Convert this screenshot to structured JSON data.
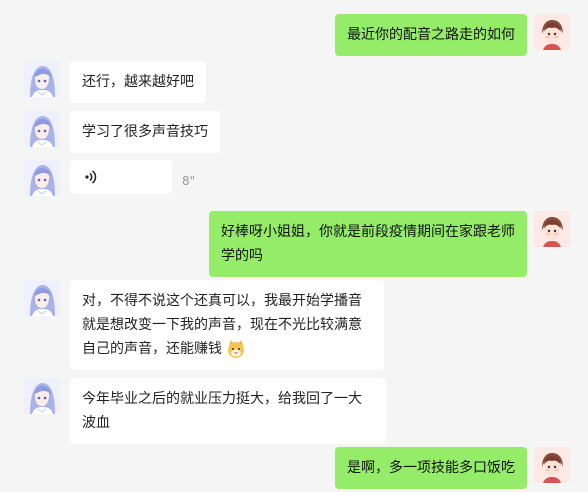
{
  "messages": [
    {
      "side": "out",
      "text": "最近你的配音之路走的如何"
    },
    {
      "side": "in",
      "text": "还行，越来越好吧"
    },
    {
      "side": "in",
      "text": "学习了很多声音技巧"
    },
    {
      "side": "in",
      "type": "voice",
      "icon": "voice-wave-icon",
      "duration": "8\""
    },
    {
      "side": "out",
      "text": "好棒呀小姐姐，你就是前段疫情期间在家跟老师学的吗"
    },
    {
      "side": "in",
      "text": "对，不得不说这个还真可以，我最开始学播音就是想改变一下我的声音，现在不光比较满意自己的声音，还能赚钱",
      "emoji": "cat-emoji-icon"
    },
    {
      "side": "in",
      "text": "今年毕业之后的就业压力挺大，给我回了一大波血"
    },
    {
      "side": "out",
      "text": "是啊，多一项技能多口饭吃"
    }
  ],
  "colors": {
    "background": "#f5f5f5",
    "bubble_in": "#ffffff",
    "bubble_out": "#95ec69",
    "duration_text": "#9a9a9a"
  }
}
